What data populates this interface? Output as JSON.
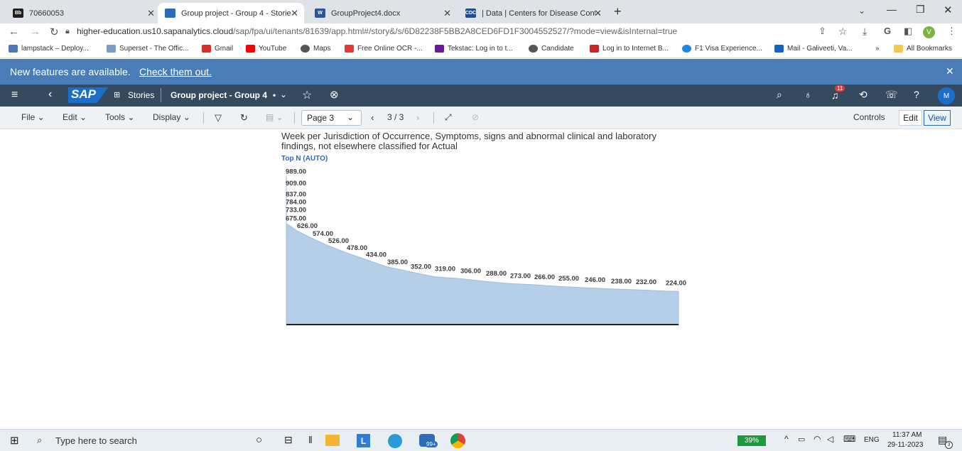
{
  "browser": {
    "tabs": [
      {
        "label": "70660053",
        "icon": "bb-icon",
        "color": "#1e1e1e",
        "active": false
      },
      {
        "label": "Group project - Group 4 - Storie",
        "icon": "sap-icon",
        "color": "#2a6ab8",
        "active": true
      },
      {
        "label": "GroupProject4.docx",
        "icon": "word-icon",
        "color": "#2b579a",
        "active": false
      },
      {
        "label": "| Data | Centers for Disease Cont",
        "icon": "cdc-icon",
        "color": "#1f4e8c",
        "active": false
      }
    ],
    "url_host": "higher-education.us10.sapanalytics.cloud",
    "url_path": "/sap/fpa/ui/tenants/81639/app.html#/story&/s/6D82238F5BB2A8CED6FD1F3004552527/?mode=view&isInternal=true",
    "profile_letter": "V",
    "bookmarks": [
      {
        "label": "lampstack – Deploy...",
        "color": "#4a78b8"
      },
      {
        "label": "Superset - The Offic...",
        "color": "#7a9cc6"
      },
      {
        "label": "Gmail",
        "color": "#d93025"
      },
      {
        "label": "YouTube",
        "color": "#ff0000"
      },
      {
        "label": "Maps",
        "color": "#555555"
      },
      {
        "label": "Free Online OCR -...",
        "color": "#e53935"
      },
      {
        "label": "Tekstac: Log in to t...",
        "color": "#6a1b9a"
      },
      {
        "label": "Candidate",
        "color": "#555555"
      },
      {
        "label": "Log in to Internet B...",
        "color": "#c62828"
      },
      {
        "label": "F1 Visa Experience...",
        "color": "#1e88e5"
      },
      {
        "label": "Mail - Galiveeti, Va...",
        "color": "#1565c0"
      }
    ],
    "bookmarks_overflow": "»",
    "all_bookmarks": "All Bookmarks"
  },
  "banner": {
    "text": "New features are available.",
    "link": "Check them out."
  },
  "sap": {
    "logo": "SAP",
    "stories_label": "Stories",
    "story_title": "Group project - Group 4",
    "story_modified": "•",
    "notification_count": "11",
    "user_initial": "M"
  },
  "toolbar": {
    "menus": [
      "File",
      "Edit",
      "Tools",
      "Display"
    ],
    "page_selector": "Page 3",
    "page_indicator": "3 / 3",
    "controls": "Controls",
    "edit": "Edit",
    "view": "View"
  },
  "chart_data": {
    "type": "area",
    "title": "Week per Jurisdiction of Occurrence, Symptoms, signs and abnormal clinical and laboratory findings, not elsewhere classified for Actual",
    "subtitle": "Top N (AUTO)",
    "values": [
      989.0,
      909.0,
      837.0,
      784.0,
      733.0,
      675.0,
      626.0,
      574.0,
      526.0,
      478.0,
      434.0,
      385.0,
      352.0,
      319.0,
      306.0,
      288.0,
      273.0,
      266.0,
      255.0,
      246.0,
      238.0,
      232.0,
      224.0
    ],
    "labels": [
      "989.00",
      "909.00",
      "837.00",
      "784.00",
      "733.00",
      "675.00",
      "626.00",
      "574.00",
      "526.00",
      "478.00",
      "434.00",
      "385.00",
      "352.00",
      "319.00",
      "306.00",
      "288.00",
      "273.00",
      "266.00",
      "255.00",
      "246.00",
      "238.00",
      "232.00",
      "224.00"
    ],
    "ylim": [
      0,
      1000
    ],
    "fill_color": "#b6cfe9",
    "stroke_color": "#9dbde0"
  },
  "taskbar": {
    "search_placeholder": "Type here to search",
    "badge": "99+",
    "battery": "39%",
    "lang": "ENG",
    "time": "11:37 AM",
    "date": "29-11-2023",
    "notif_count": "3"
  }
}
